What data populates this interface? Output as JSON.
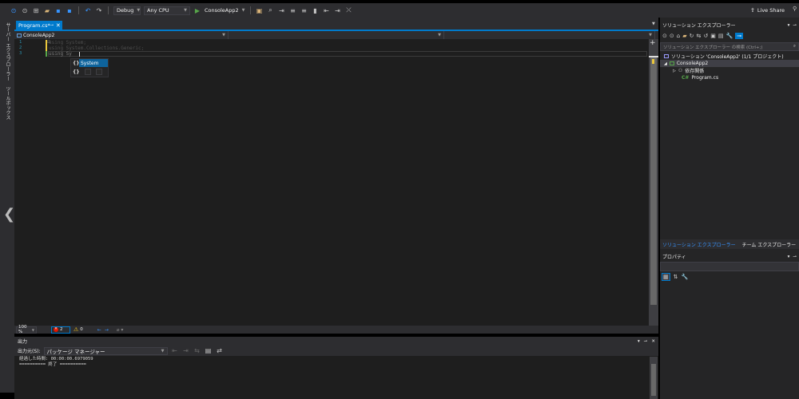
{
  "toolbar": {
    "config": "Debug",
    "platform": "Any CPU",
    "run_target": "ConsoleApp2",
    "live_share": "Live Share"
  },
  "leftbar": {
    "server_explorer": "サーバー エクスプローラー",
    "toolbox": "ツールボックス"
  },
  "editor": {
    "tab_name": "Program.cs*",
    "nav_project": "ConsoleApp2",
    "lines": [
      {
        "num": "1",
        "text": "using System;"
      },
      {
        "num": "2",
        "text": "using System.Collections.Generic;"
      },
      {
        "num": "3",
        "text": "using Sy"
      }
    ],
    "completion": {
      "icon": "{}",
      "item": "System"
    },
    "zoom": "100 %",
    "errors": "2",
    "warnings": "0"
  },
  "output": {
    "title": "出力",
    "source_label": "出力元(S):",
    "source_value": "パッケージ マネージャー",
    "lines": "経過した時間: 00:00:00.6979059\n========== 終了 =========="
  },
  "solution_explorer": {
    "title": "ソリューション エクスプローラー",
    "search_placeholder": "ソリューション エクスプローラー の検索 (Ctrl+;)",
    "solution": "ソリューション 'ConsoleApp2' (1/1 プロジェクト)",
    "project": "ConsoleApp2",
    "dependencies": "依存関係",
    "file": "Program.cs",
    "tab_solution": "ソリューション エクスプローラー",
    "tab_team": "チーム エクスプローラー"
  },
  "properties": {
    "title": "プロパティ"
  },
  "colors": {
    "accent": "#007acc",
    "background": "#1e1e1e",
    "chrome": "#2d2d30"
  }
}
